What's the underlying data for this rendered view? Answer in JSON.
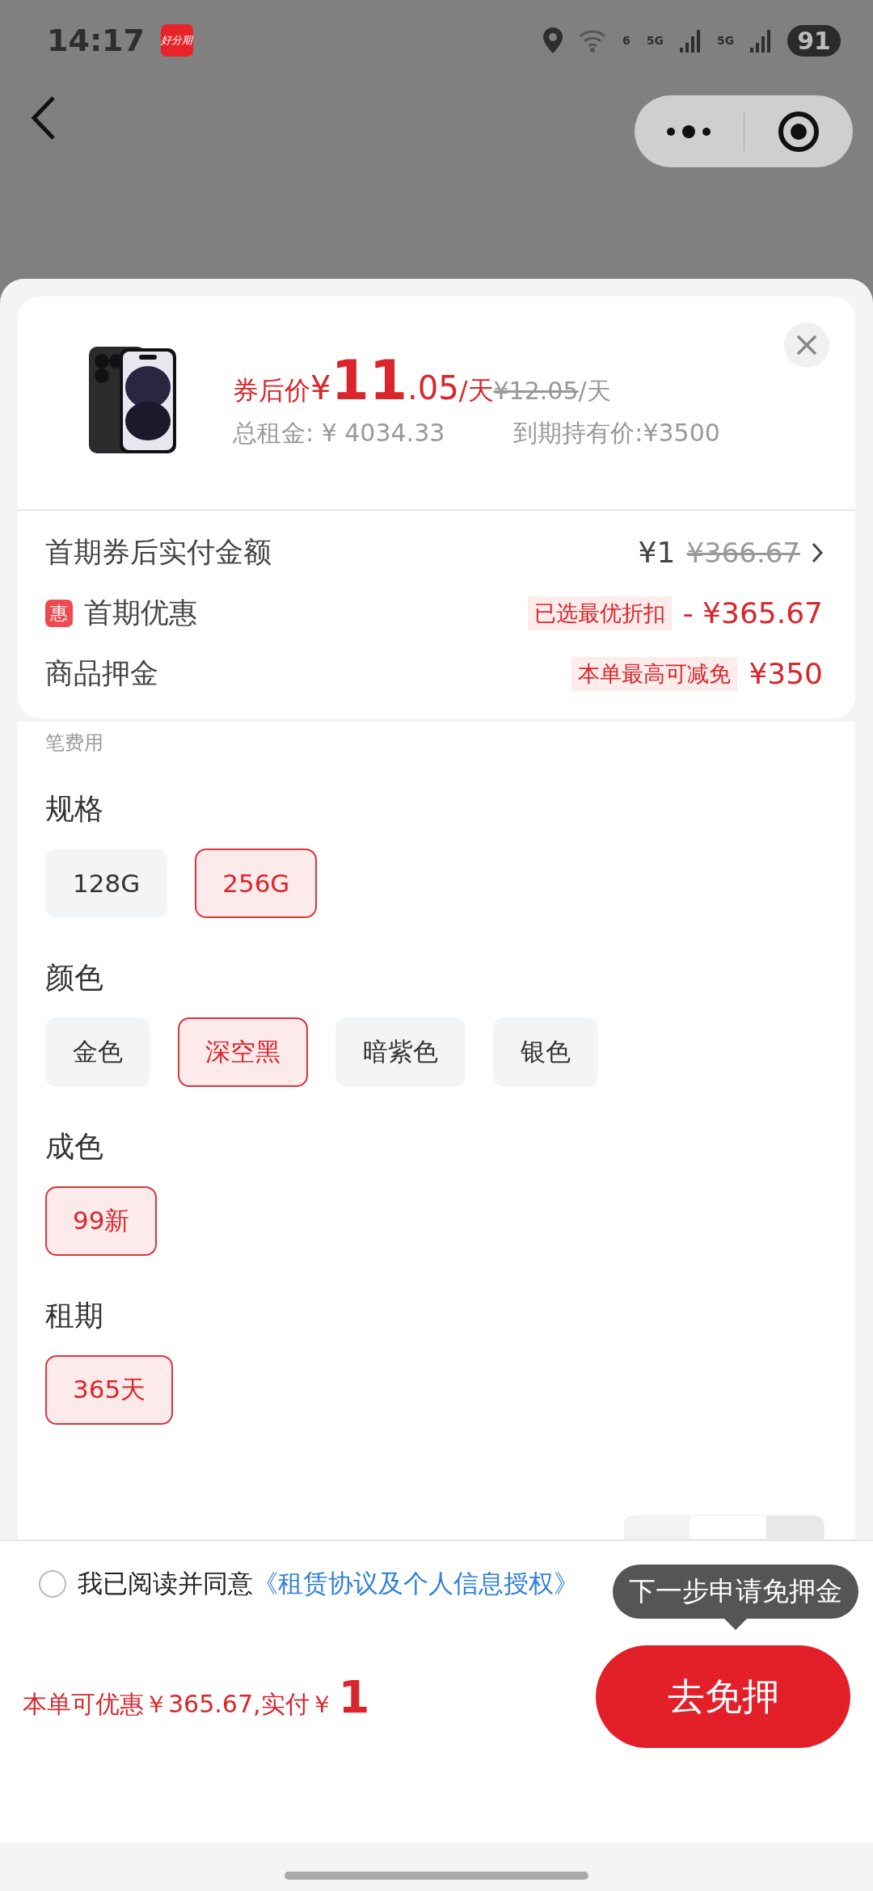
{
  "status_bar": {
    "time": "14:17",
    "app_icon_text": "好分期",
    "wifi_badge": "6",
    "sim_labels": [
      "5G",
      "5G"
    ],
    "battery": "91"
  },
  "product": {
    "kind": "picture",
    "price_label": "券后价",
    "currency": "¥",
    "price_int": "11",
    "price_dec": ".05",
    "unit": "/天",
    "original_price": "¥12.05",
    "original_unit": "/天",
    "total_rent": "总租金: ¥ 4034.33",
    "hold_price": "到期持有价:¥3500"
  },
  "fee_rows": [
    {
      "kind": "payment",
      "label": "首期券后实付金额",
      "value": "¥1",
      "struck_value": "¥366.67"
    },
    {
      "kind": "discount",
      "badge": "惠",
      "label": "首期优惠",
      "tag": "已选最优折扣",
      "value": "- ¥365.67"
    },
    {
      "kind": "deposit",
      "label": "商品押金",
      "tag": "本单最高可减免",
      "value": "¥350"
    }
  ],
  "fee_note": "笔费用",
  "option_groups": [
    {
      "title": "规格",
      "options": [
        {
          "label": "128G",
          "selected": false
        },
        {
          "label": "256G",
          "selected": true
        }
      ]
    },
    {
      "title": "颜色",
      "options": [
        {
          "label": "金色",
          "selected": false
        },
        {
          "label": "深空黑",
          "selected": true
        },
        {
          "label": "暗紫色",
          "selected": false
        },
        {
          "label": "银色",
          "selected": false
        }
      ]
    },
    {
      "title": "成色",
      "options": [
        {
          "label": "99新",
          "selected": true
        }
      ]
    },
    {
      "title": "租期",
      "options": [
        {
          "label": "365天",
          "selected": true
        }
      ]
    }
  ],
  "footer": {
    "agreement": {
      "checked": false,
      "text": "我已阅读并同意",
      "link": "《租赁协议及个人信息授权》"
    },
    "tooltip": "下一步申请免押金",
    "summary_text": "本单可优惠￥365.67,实付",
    "summary_currency": "￥",
    "summary_amount": "1",
    "button": "去免押"
  }
}
